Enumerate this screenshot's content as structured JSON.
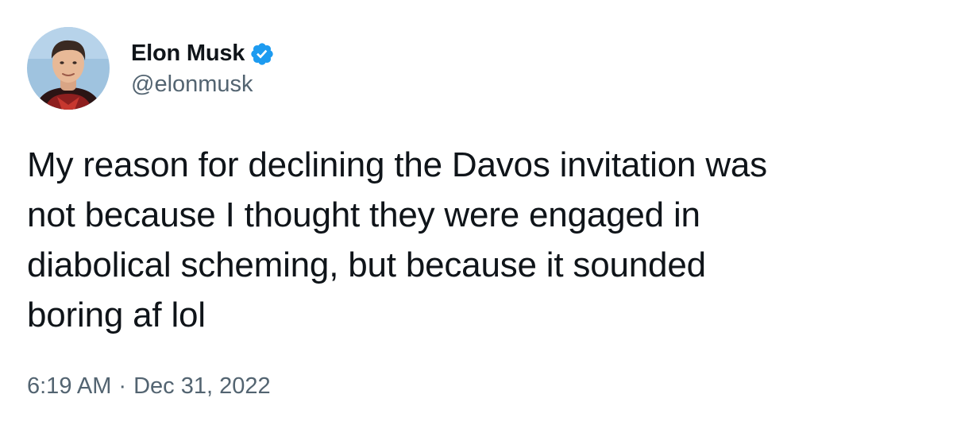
{
  "author": {
    "display_name": "Elon Musk",
    "handle": "@elonmusk",
    "verified": true,
    "verified_color": "#1d9bf0",
    "avatar_icon": "profile-photo"
  },
  "tweet": {
    "text": "My reason for declining the Davos invitation was\nnot because I thought they were engaged in\ndiabolical scheming, but because it sounded\nboring af lol"
  },
  "meta": {
    "time": "6:19 AM",
    "separator": "·",
    "date": "Dec 31, 2022"
  },
  "colors": {
    "text_primary": "#0f1419",
    "text_secondary": "#536471",
    "background": "#ffffff"
  }
}
